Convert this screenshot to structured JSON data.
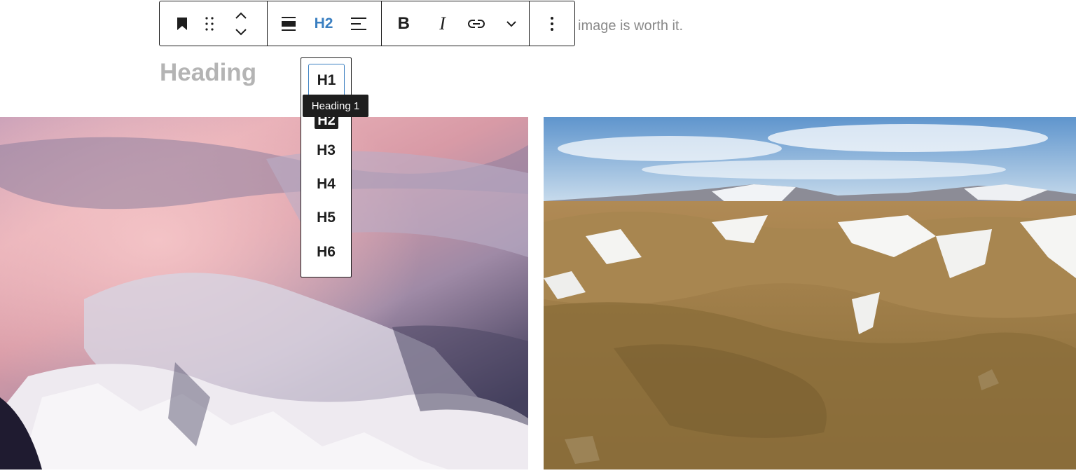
{
  "background_text": "image is worth it.",
  "heading_placeholder": "Heading",
  "toolbar": {
    "heading_level_label": "H2",
    "bold_label": "B",
    "italic_label": "I"
  },
  "heading_dropdown": {
    "items": [
      "H1",
      "H2",
      "H3",
      "H4",
      "H5",
      "H6"
    ],
    "focused": "H1",
    "active": "H2"
  },
  "tooltip": "Heading 1",
  "colors": {
    "accent": "#3a7fc1",
    "toolbar_border": "#1e1e1e",
    "placeholder_text": "#b4b4b4"
  },
  "icons": {
    "block_type": "bookmark-icon",
    "drag": "drag-handle-icon",
    "move": "move-up-down-icon",
    "align": "align-icon",
    "text_align": "text-align-left-icon",
    "link": "link-icon",
    "more_rich_text": "chevron-down-icon",
    "options": "more-vertical-icon"
  },
  "images": [
    "pink-clouds-snowy-mountains-aerial",
    "iceland-highlands-snow-patches"
  ]
}
